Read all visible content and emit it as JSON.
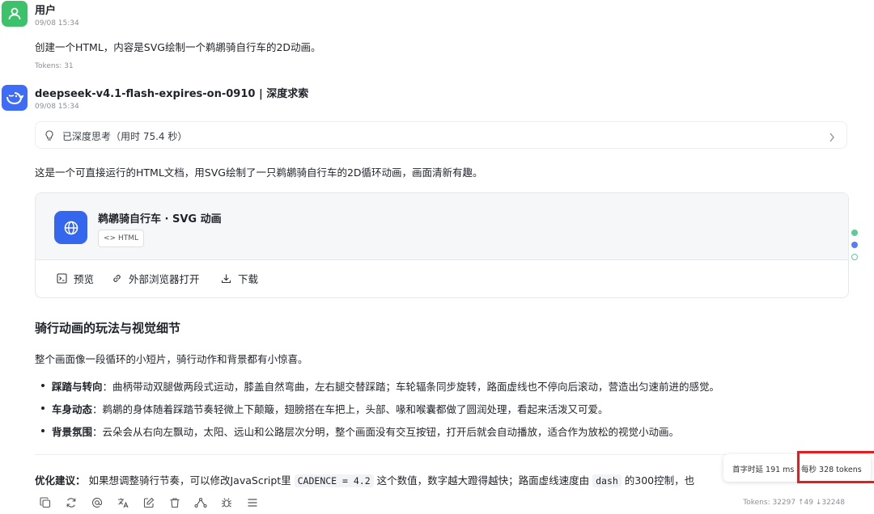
{
  "user_message": {
    "author": "用户",
    "time": "09/08 15:34",
    "text": "创建一个HTML，内容是SVG绘制一个鹈鹕骑自行车的2D动画。",
    "tokens": "Tokens: 31"
  },
  "bot_message": {
    "author": "deepseek-v4.1-flash-expires-on-0910 | 深度求索",
    "time": "09/08 15:34",
    "thinking_label": "已深度思考（用时 75.4 秒）",
    "intro": "这是一个可直接运行的HTML文档，用SVG绘制了一只鹈鹕骑自行车的2D循环动画，画面清新有趣。",
    "artifact": {
      "title": "鹈鹕骑自行车 · SVG 动画",
      "badge": "<> HTML",
      "actions": {
        "preview": "预览",
        "open_external": "外部浏览器打开",
        "download": "下载"
      }
    },
    "heading": "骑行动画的玩法与视觉细节",
    "paragraph": "整个画面像一段循环的小短片，骑行动作和背景都有小惊喜。",
    "bullets": [
      {
        "label": "踩踏与转向",
        "text": "：曲柄带动双腿做两段式运动，膝盖自然弯曲，左右腿交替踩踏；车轮辐条同步旋转，路面虚线也不停向后滚动，营造出匀速前进的感觉。"
      },
      {
        "label": "车身动态",
        "text": "：鹈鹕的身体随着踩踏节奏轻微上下颠簸，翅膀搭在车把上，头部、喙和喉囊都做了圆润处理，看起来活泼又可爱。"
      },
      {
        "label": "背景氛围",
        "text": "：云朵会从右向左飘动，太阳、远山和公路层次分明，整个画面没有交互按钮，打开后就会自动播放，适合作为放松的视觉小动画。"
      }
    ],
    "tip": {
      "label": "优化建议：",
      "part1": " 如果想调整骑行节奏，可以修改JavaScript里 ",
      "code1": "CADENCE = 4.2",
      "part2": " 这个数值，数字越大蹬得越快；路面虚线速度由 ",
      "code2": "dash",
      "part3": " 的300控制，也"
    },
    "footer_tokens": "Tokens: 32297 ↑49 ↓32248"
  },
  "stats": {
    "first_token": "首字时延 191 ms",
    "per_second": "每秒 328 tokens"
  },
  "colors": {
    "user_avatar": "#3dc26b",
    "bot_avatar": "#3f6cf6",
    "highlight_box": "#e02020"
  },
  "toolbar_icons": [
    "copy-icon",
    "regenerate-icon",
    "mention-icon",
    "translate-icon",
    "edit-icon",
    "delete-icon",
    "branch-icon",
    "debug-icon",
    "menu-icon"
  ]
}
